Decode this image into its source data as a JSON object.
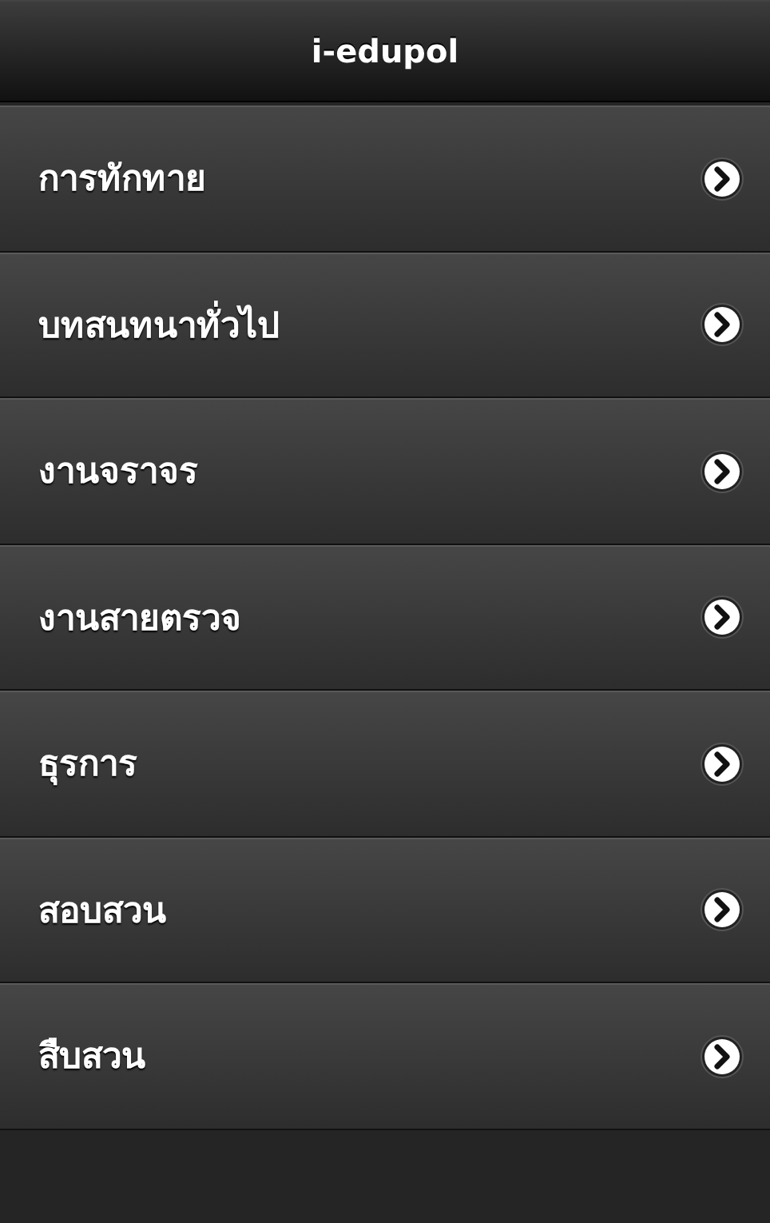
{
  "header": {
    "title": "i-edupol"
  },
  "items": [
    {
      "label": "การทักทาย"
    },
    {
      "label": "บทสนทนาทั่วไป"
    },
    {
      "label": "งานจราจร"
    },
    {
      "label": "งานสายตรวจ"
    },
    {
      "label": "ธุรการ"
    },
    {
      "label": "สอบสวน"
    },
    {
      "label": "สืบสวน"
    }
  ]
}
